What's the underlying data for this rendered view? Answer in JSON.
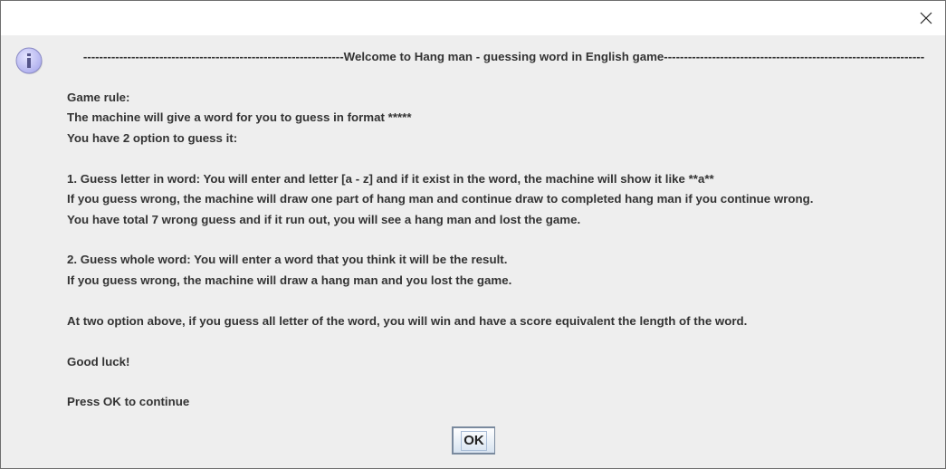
{
  "dialog": {
    "close_icon": "close-x-icon",
    "message_icon": "information-icon",
    "header_line": "-----------------------------------------------------------------Welcome to Hang man - guessing word in English game-----------------------------------------------------------------",
    "lines": [
      "",
      "Game rule:",
      "The machine will give a word for you to guess in format *****",
      "You have 2 option to guess it:",
      "",
      "1. Guess letter in word: You will enter and letter [a - z] and if it exist in the word, the machine will show it like **a**",
      "If you guess wrong, the machine will draw one part of hang man and continue draw to completed hang man if you continue wrong.",
      "You have total 7 wrong guess and if it run out, you will see a hang man and lost the game.",
      "",
      "2. Guess whole word: You will enter a word that you think it will be the result.",
      "If you guess wrong, the machine will draw a hang man and you lost the game.",
      "",
      "At two option above, if you guess all letter of the word, you will win and have a score equivalent the length of the word.",
      "",
      "Good luck!",
      "",
      "Press OK to continue"
    ],
    "ok_label": "OK"
  }
}
